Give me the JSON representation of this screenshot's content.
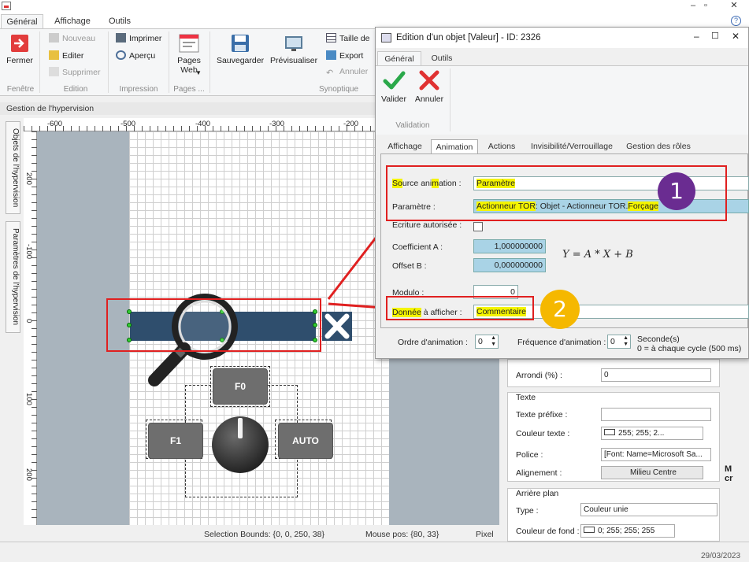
{
  "ribbon": {
    "tabs": [
      "Général",
      "Affichage",
      "Outils"
    ],
    "fermer": "Fermer",
    "nouveau": "Nouveau",
    "editer": "Editer",
    "supprimer": "Supprimer",
    "imprimer": "Imprimer",
    "apercu": "Aperçu",
    "pages_web": "Pages Web",
    "sauvegarder": "Sauvegarder",
    "previsualiser": "Prévisualiser",
    "taille_de": "Taille de",
    "export": "Export",
    "annuler": "Annuler",
    "groups": {
      "fenetre": "Fenêtre",
      "edition": "Edition",
      "impression": "Impression",
      "pages": "Pages ...",
      "synoptique": "Synoptique"
    }
  },
  "panel": {
    "title": "Gestion de l'hypervision",
    "side_tabs": [
      "Objets de l'hypervision",
      "Paramètres de l'hypervision"
    ]
  },
  "ruler": {
    "top": [
      "-600",
      "-500",
      "-400",
      "-300",
      "-200"
    ],
    "left": [
      "200",
      "-100",
      "0",
      "100",
      "200"
    ]
  },
  "canvas": {
    "buttons": {
      "f0": "F0",
      "f1": "F1",
      "auto": "AUTO"
    }
  },
  "status": {
    "selection": "Selection Bounds: {0, 0, 250, 38}",
    "mouse": "Mouse pos: {80, 33}",
    "unit": "Pixel",
    "date": "29/03/2023"
  },
  "dialog": {
    "title": "Edition d'un objet [Valeur] - ID: 2326",
    "tabs": [
      "Général",
      "Outils"
    ],
    "valider": "Valider",
    "annuler": "Annuler",
    "validation": "Validation",
    "subtabs": [
      "Affichage",
      "Animation",
      "Actions",
      "Invisibilité/Verrouillage",
      "Gestion des rôles"
    ],
    "source_label_parts": [
      "So",
      "u",
      "rce ani",
      "m",
      "ation :"
    ],
    "source_value": "Paramètre",
    "parametre_label": "Paramètre :",
    "parametre_value_parts": [
      "Actionneur TOR",
      ": Objet - Actionneur TOR.",
      "Forçage"
    ],
    "ecriture_label": "Ecriture autorisée :",
    "coef_label": "Coefficient A :",
    "coef_value": "1,000000000",
    "offset_label": "Offset B :",
    "offset_value": "0,000000000",
    "formula": "Y = A * X + B",
    "modulo_label": "Modulo :",
    "modulo_value": "0",
    "donnee_label_parts": [
      "Donnée",
      " à afficher :"
    ],
    "donnee_value": "Commentaire",
    "ordre_label": "Ordre d'animation :",
    "ordre_value": "0",
    "freq_label": "Fréquence d'animation :",
    "freq_value": "0",
    "freq_unit": "Seconde(s)",
    "freq_note": "0 = à chaque cycle (500 ms)"
  },
  "badges": [
    "1",
    "2"
  ],
  "props": {
    "arrondi_label": "Arrondi (%) :",
    "arrondi_value": "0",
    "texte_group": "Texte",
    "prefixe_label": "Texte préfixe :",
    "couleur_texte_label": "Couleur texte :",
    "couleur_texte_value": "255; 255; 2...",
    "police_label": "Police :",
    "police_value": "[Font: Name=Microsoft Sa...",
    "alignement_label": "Alignement :",
    "alignement_value": "Milieu Centre",
    "arriere_group": "Arrière plan",
    "type_label": "Type :",
    "type_value": "Couleur unie",
    "fond_label": "Couleur de fond :",
    "fond_value": "0; 255; 255; 255",
    "clipped": "M\ncr"
  },
  "colors": {
    "highlight": "#f4f400",
    "blue_field": "#a9d3e6",
    "red": "#e02020",
    "badge1": "#6a2c91",
    "badge2": "#f5b800"
  }
}
